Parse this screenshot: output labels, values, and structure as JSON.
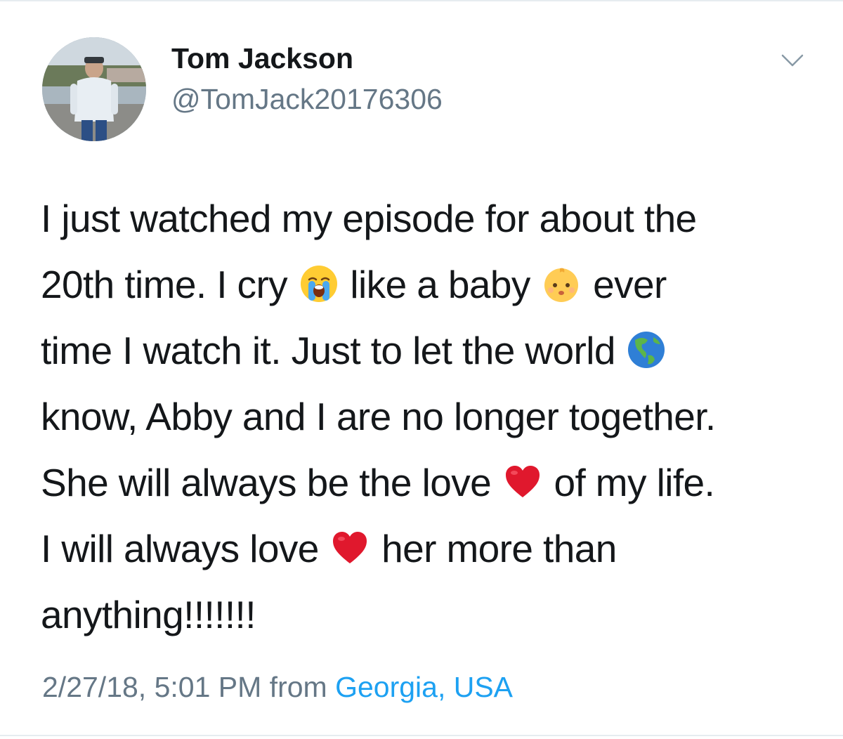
{
  "user": {
    "name": "Tom Jackson",
    "handle": "@TomJack20176306"
  },
  "tweet": {
    "lines": [
      [
        {
          "t": "text",
          "v": "I just watched my episode for about the"
        }
      ],
      [
        {
          "t": "text",
          "v": "20th time. I cry "
        },
        {
          "t": "emoji",
          "icon": "loudly-crying-face-emoji"
        },
        {
          "t": "text",
          "v": " like a baby "
        },
        {
          "t": "emoji",
          "icon": "baby-face-emoji"
        },
        {
          "t": "text",
          "v": " ever"
        }
      ],
      [
        {
          "t": "text",
          "v": "time I watch it. Just to let the world "
        },
        {
          "t": "emoji",
          "icon": "globe-americas-emoji"
        }
      ],
      [
        {
          "t": "text",
          "v": "know, Abby and I are no longer together."
        }
      ],
      [
        {
          "t": "text",
          "v": "She will always be the love "
        },
        {
          "t": "emoji",
          "icon": "red-heart-emoji"
        },
        {
          "t": "text",
          "v": " of my life."
        }
      ],
      [
        {
          "t": "text",
          "v": "I will always love "
        },
        {
          "t": "emoji",
          "icon": "red-heart-emoji"
        },
        {
          "t": "text",
          "v": " her more than"
        }
      ],
      [
        {
          "t": "text",
          "v": "anything!!!!!!!"
        }
      ]
    ]
  },
  "meta": {
    "timestamp": "2/27/18, 5:01 PM",
    "from_label": "from",
    "location": "Georgia, USA"
  },
  "icons": {
    "menu": "chevron-down-icon"
  },
  "colors": {
    "text": "#14171a",
    "secondary": "#657786",
    "link": "#1da1f2",
    "divider": "#e6ecf0"
  }
}
